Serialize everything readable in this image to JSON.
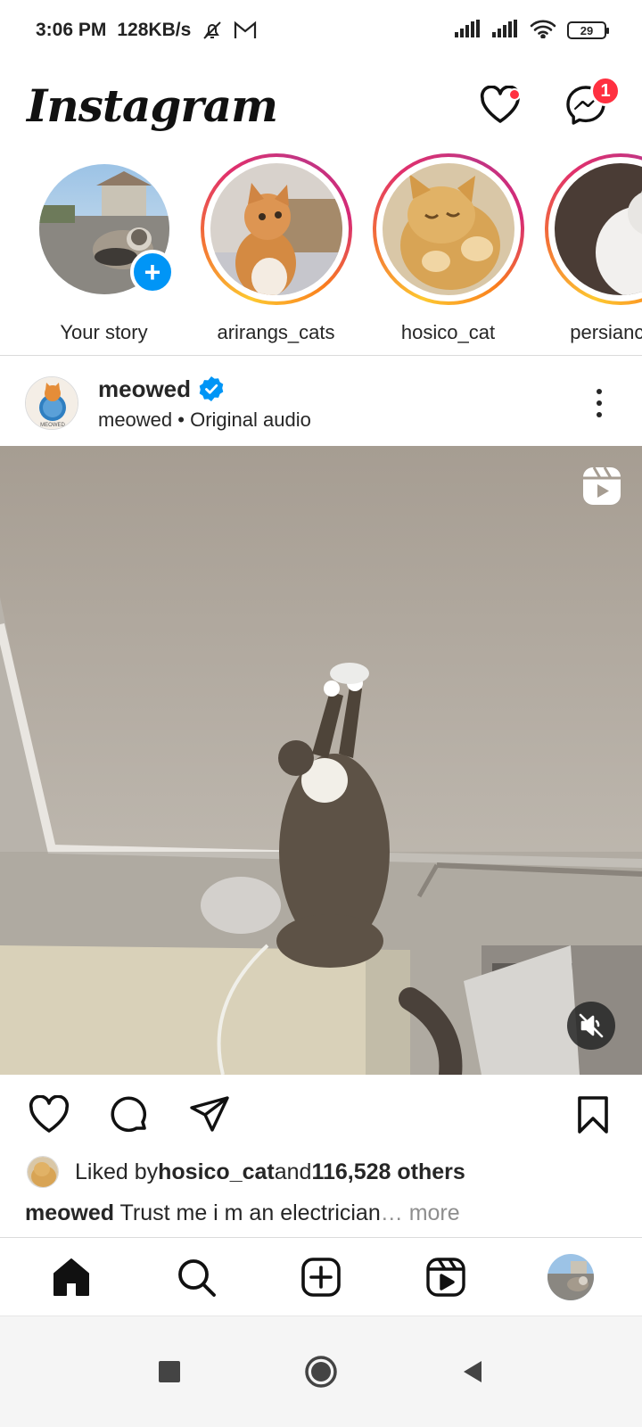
{
  "status_bar": {
    "time": "3:06 PM",
    "network_speed": "128KB/s",
    "battery_level": "29",
    "icons": [
      "bell-off-icon",
      "gmail-icon",
      "signal-icon",
      "signal-icon",
      "wifi-icon",
      "battery-icon"
    ]
  },
  "header": {
    "logo": "Instagram",
    "notification_badge": "",
    "messages_badge": "1"
  },
  "stories": [
    {
      "username": "Your story",
      "own": true
    },
    {
      "username": "arirangs_cats",
      "own": false
    },
    {
      "username": "hosico_cat",
      "own": false
    },
    {
      "username": "persiancats",
      "own": false
    }
  ],
  "post": {
    "username": "meowed",
    "verified": true,
    "subtitle": "meowed • Original audio",
    "avatar_text": "MEOWED",
    "likes_prefix": "Liked by ",
    "liked_by_user": "hosico_cat",
    "likes_middle": " and ",
    "likes_count": "116,528 others",
    "caption_user": "meowed",
    "caption_text": " Trust me i m an electrician",
    "caption_more": "… more"
  },
  "colors": {
    "accent_blue": "#0095f6",
    "badge_red": "#ff3040",
    "text_primary": "#262626",
    "text_secondary": "#8e8e8e",
    "divider": "#dbdbdb"
  }
}
